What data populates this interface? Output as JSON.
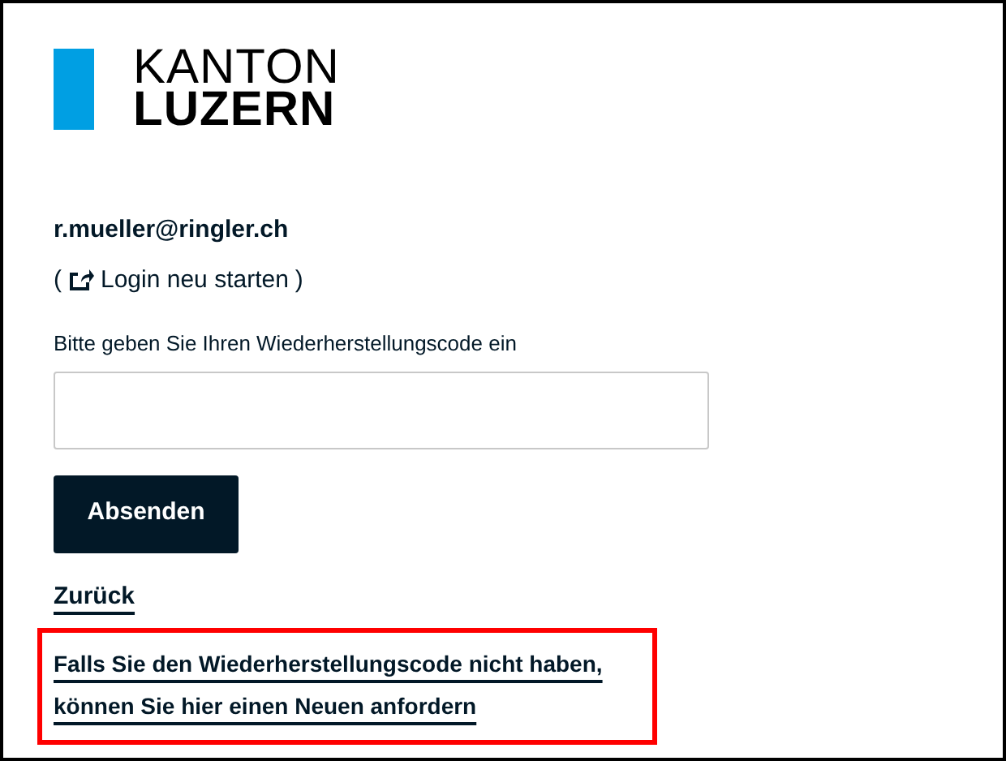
{
  "logo": {
    "line_1": "KANTON",
    "line_2": "LUZERN"
  },
  "user_email": "r.mueller@ringler.ch",
  "restart": {
    "open": "(",
    "label": "Login neu starten",
    "close": ")"
  },
  "code_field": {
    "label": "Bitte geben Sie Ihren Wiederherstellungscode ein"
  },
  "submit_button": "Absenden",
  "back_link": "Zurück",
  "request_link": {
    "text": "Falls Sie den Wiederherstellungscode nicht haben, können Sie hier einen Neuen anfordern",
    "highlighted": true
  }
}
